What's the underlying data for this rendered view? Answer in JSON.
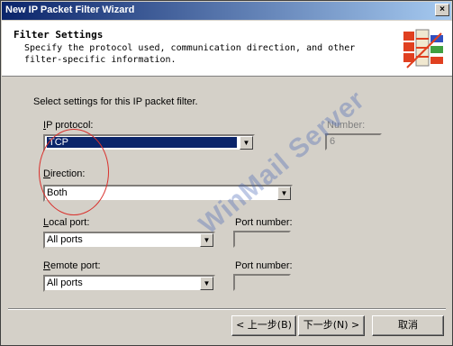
{
  "window": {
    "title": "New IP Packet Filter Wizard",
    "close_glyph": "×"
  },
  "header": {
    "title": "Filter Settings",
    "description_line1": "Specify the protocol used, communication direction, and other",
    "description_line2": "filter-specific information.",
    "icon": "wizard-filter-icon"
  },
  "form": {
    "intro": "Select settings for this IP packet filter.",
    "protocol": {
      "label_u": "I",
      "label_rest": "P protocol:",
      "value": "TCP"
    },
    "number": {
      "label": "Number:",
      "value": "6"
    },
    "direction": {
      "label_u": "D",
      "label_rest": "irection:",
      "value": "Both"
    },
    "local_port": {
      "label_u": "L",
      "label_rest": "ocal port:",
      "value": "All ports"
    },
    "local_port_number": {
      "label": "Port number:",
      "value": ""
    },
    "remote_port": {
      "label_u": "R",
      "label_rest": "emote port:",
      "value": "All ports"
    },
    "remote_port_number": {
      "label": "Port number:",
      "value": ""
    }
  },
  "buttons": {
    "back": "< 上一步(B)",
    "next": "下一步(N) >",
    "cancel": "取消"
  },
  "overlay": {
    "watermark": "WinMail Server"
  },
  "colors": {
    "title_bar": "#0a246a",
    "selection": "#0a246a",
    "annotation": "#d9302c"
  }
}
